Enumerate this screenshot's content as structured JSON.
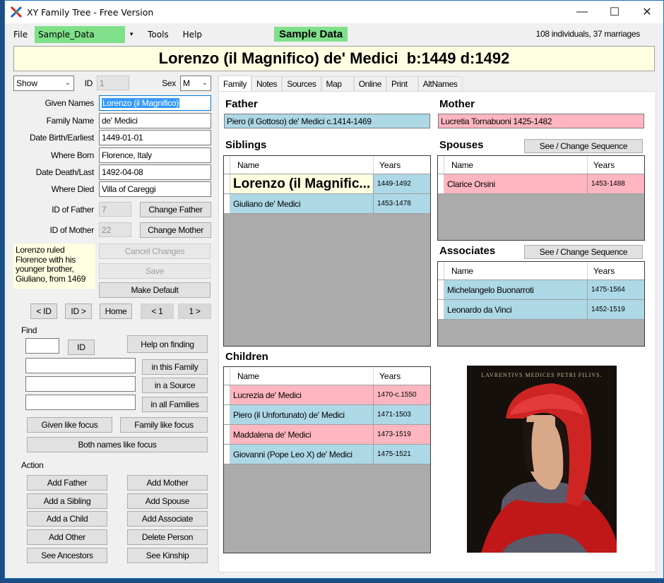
{
  "window": {
    "title": "XY Family Tree - Free Version",
    "controls": {
      "minimize": "—",
      "maximize": "☐",
      "close": "✕"
    }
  },
  "menu": {
    "file": "File",
    "database": "Sample_Data",
    "database_arrow": "▾",
    "tools": "Tools",
    "help": "Help",
    "badge": "Sample Data",
    "stats": "108 individuals, 37 marriages"
  },
  "header": {
    "person_title": "Lorenzo (il Magnifico) de' Medici  b:1449 d:1492"
  },
  "colors": {
    "male": "#add8e6",
    "female": "#ffb6c1",
    "focus": "#ffffe1",
    "badge": "#7fe08a"
  },
  "left": {
    "show_select": "Show",
    "id_label": "ID",
    "id_value": "1",
    "sex_label": "Sex",
    "sex_value": "M",
    "fields": [
      {
        "label": "Given Names",
        "value": "Lorenzo (il Magnifico)"
      },
      {
        "label": "Family Name",
        "value": "de' Medici"
      },
      {
        "label": "Date Birth/Earliest",
        "value": "1449-01-01"
      },
      {
        "label": "Where Born",
        "value": "Florence, Italy"
      },
      {
        "label": "Date Death/Last",
        "value": "1492-04-08"
      },
      {
        "label": "Where Died",
        "value": "Villa of Careggi"
      }
    ],
    "father_id_label": "ID of Father",
    "father_id": "7",
    "change_father": "Change Father",
    "mother_id_label": "ID of Mother",
    "mother_id": "22",
    "change_mother": "Change Mother",
    "note": "Lorenzo ruled Florence with his younger brother, Giuliano, from 1469",
    "cancel_changes": "Cancel Changes",
    "save": "Save",
    "make_default": "Make Default",
    "nav": {
      "prev_id": "< ID",
      "next_id": "ID >",
      "home": "Home",
      "prev_1": "< 1",
      "next_1": "1 >"
    },
    "find": {
      "label": "Find",
      "id_btn": "ID",
      "help": "Help on finding",
      "in_family": "in this Family",
      "in_source": "in a Source",
      "in_all": "in all Families",
      "given_like": "Given like focus",
      "family_like": "Family like focus",
      "both_like": "Both names like focus"
    },
    "action": {
      "label": "Action",
      "buttons": [
        "Add Father",
        "Add Mother",
        "Add a Sibling",
        "Add Spouse",
        "Add a Child",
        "Add Associate",
        "Add Other",
        "Delete Person",
        "See Ancestors",
        "See Kinship"
      ]
    }
  },
  "tabs": [
    "Family",
    "Notes",
    "Sources",
    "Map",
    "Online",
    "Print",
    "AltNames"
  ],
  "family": {
    "father_title": "Father",
    "father": "Piero (il Gottoso) de' Medici c.1414-1469",
    "mother_title": "Mother",
    "mother": "Lucretia Tornabuoni 1425-1482",
    "col_name": "Name",
    "col_years": "Years",
    "siblings_title": "Siblings",
    "siblings": [
      {
        "name": "Lorenzo (il Magnific...",
        "years": "1449-1492",
        "sex": "focus"
      },
      {
        "name": "Giuliano de' Medici",
        "years": "1453-1478",
        "sex": "male"
      }
    ],
    "spouses_title": "Spouses",
    "seq_btn": "See / Change Sequence",
    "spouses": [
      {
        "name": "Clarice Orsini",
        "years": "1453-1488",
        "sex": "female"
      }
    ],
    "associates_title": "Associates",
    "associates": [
      {
        "name": "Michelangelo Buonarroti",
        "years": "1475-1564",
        "sex": "male"
      },
      {
        "name": "Leonardo da Vinci",
        "years": "1452-1519",
        "sex": "male"
      }
    ],
    "children_title": "Children",
    "children": [
      {
        "name": "Lucrezia de' Medici",
        "years": "1470-c.1550",
        "sex": "female"
      },
      {
        "name": "Piero (il Unfortunato) de' Medici",
        "years": "1471-1503",
        "sex": "male"
      },
      {
        "name": "Maddalena de' Medici",
        "years": "1473-1519",
        "sex": "female"
      },
      {
        "name": "Giovanni (Pope Leo X) de' Medici",
        "years": "1475-1521",
        "sex": "male"
      }
    ],
    "portrait_caption": "LAVRENTIVS MEDICES PETRI FILIVS."
  }
}
